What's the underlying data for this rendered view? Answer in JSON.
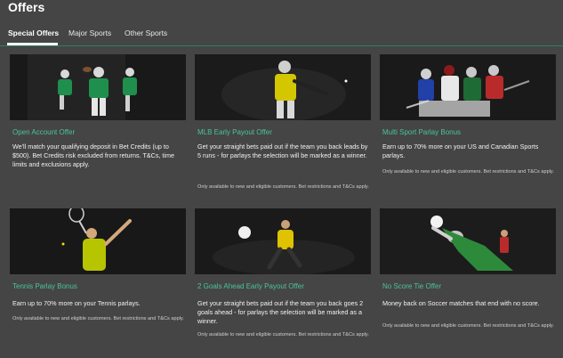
{
  "page": {
    "title": "Offers"
  },
  "tabs": [
    {
      "label": "Special Offers",
      "active": true
    },
    {
      "label": "Major Sports",
      "active": false
    },
    {
      "label": "Other Sports",
      "active": false
    }
  ],
  "colors": {
    "accent": "#49c49a",
    "background": "#454545",
    "divider": "#2f7d64"
  },
  "offers": [
    {
      "title": "Open Account Offer",
      "description": "We'll match your qualifying deposit in Bet Credits (up to $500). Bet Credits risk excluded from returns. T&Cs, time limits and exclusions apply.",
      "note": "",
      "image": "american-football-players-image"
    },
    {
      "title": "MLB Early Payout Offer",
      "description": "Get your straight bets paid out if the team you back leads by 5 runs - for parlays the selection will be marked as a winner.",
      "note": "Only available to new and eligible customers. Bet restrictions and T&Cs apply.",
      "image": "baseball-batter-image"
    },
    {
      "title": "Multi Sport Parlay Bonus",
      "description": "Earn up to 70% more on your US and Canadian Sports parlays.",
      "note": "Only available to new and eligible customers. Bet restrictions and T&Cs apply.",
      "image": "multi-sport-athletes-image"
    },
    {
      "title": "Tennis Parlay Bonus",
      "description": "Earn up to 70% more on your Tennis parlays.",
      "note": "Only available to new and eligible customers. Bet restrictions and T&Cs apply.",
      "image": "tennis-player-image"
    },
    {
      "title": "2 Goals Ahead Early Payout Offer",
      "description": "Get your straight bets paid out if the team you back goes 2 goals ahead - for parlays the selection will be marked as a winner.",
      "note": "Only available to new and eligible customers. Bet restrictions and T&Cs apply.",
      "image": "soccer-player-kicking-image"
    },
    {
      "title": "No Score Tie Offer",
      "description": "Money back on Soccer matches that end with no score.",
      "note": "Only available to new and eligible customers. Bet restrictions and T&Cs apply.",
      "image": "goalkeeper-diving-image"
    }
  ]
}
